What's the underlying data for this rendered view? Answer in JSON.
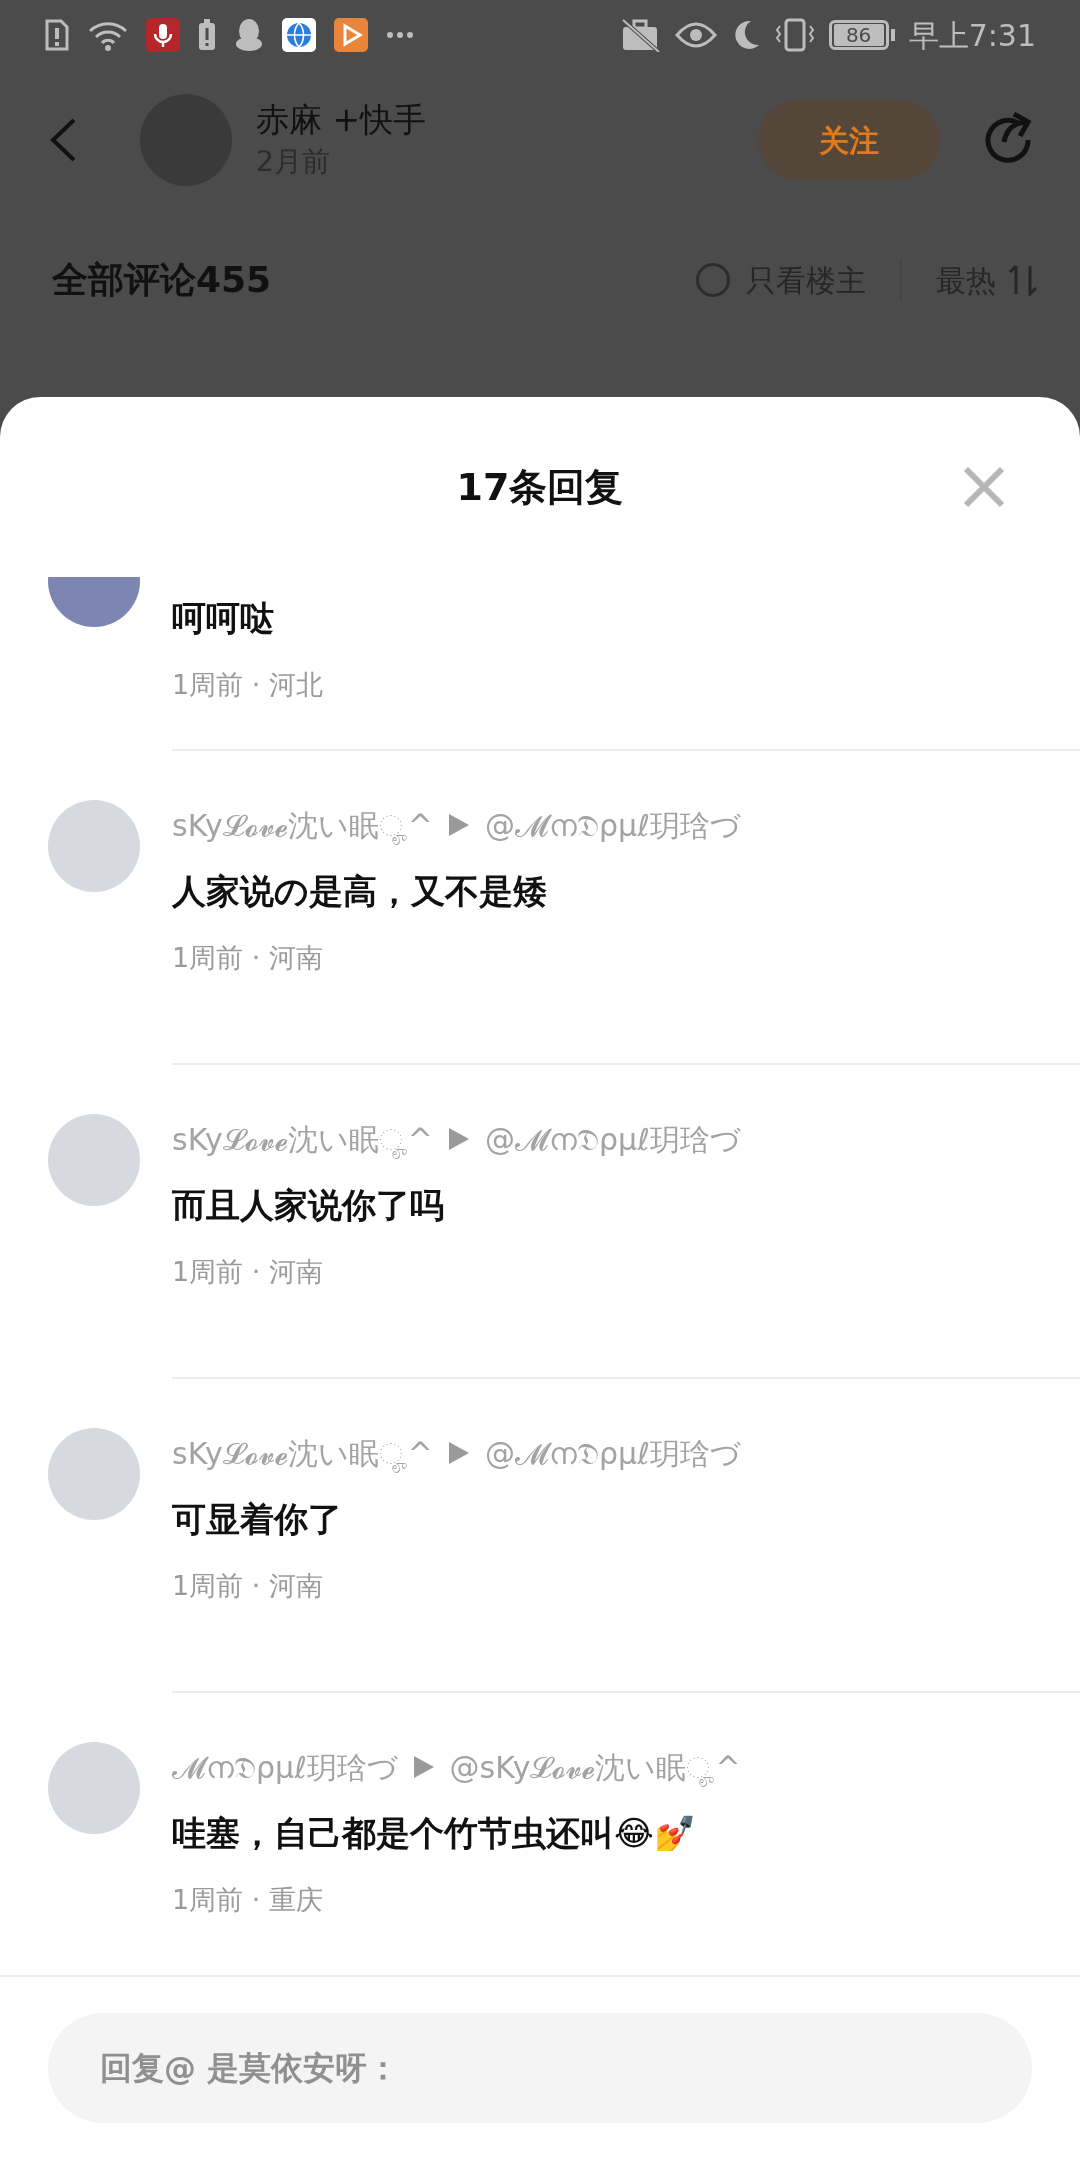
{
  "status_bar": {
    "battery": "86",
    "time": "早上7:31"
  },
  "post_header": {
    "author": "赤麻 +快手",
    "time": "2月前",
    "follow_button": "关注"
  },
  "comments_bar": {
    "title": "全部评论455",
    "owner_only": {
      "label": "只看楼主",
      "checked": false
    },
    "sort": "最热"
  },
  "reply_sheet": {
    "title": "17条回复",
    "replies": [
      {
        "kind": "partial",
        "text": "呵呵哒",
        "meta": "1周前 · 河北"
      },
      {
        "kind": "full",
        "author": "sKy𝓛𝓸𝓿𝓮沈い眠ೄ^",
        "reply_to": "@𝓜ന𝔇ρμℓ玥琀づ",
        "text": "人家说の是高，又不是矮",
        "meta": "1周前 · 河南"
      },
      {
        "kind": "full",
        "author": "sKy𝓛𝓸𝓿𝓮沈い眠ೄ^",
        "reply_to": "@𝓜ന𝔇ρμℓ玥琀づ",
        "text": "而且人家说你了吗",
        "meta": "1周前 · 河南"
      },
      {
        "kind": "full",
        "author": "sKy𝓛𝓸𝓿𝓮沈い眠ೄ^",
        "reply_to": "@𝓜ന𝔇ρμℓ玥琀づ",
        "text": "可显着你了",
        "meta": "1周前 · 河南"
      },
      {
        "kind": "full",
        "author": "𝓜ന𝔇ρμℓ玥琀づ",
        "reply_to": "@sKy𝓛𝓸𝓿𝓮沈い眠ೄ^",
        "text": "哇塞，自己都是个竹节虫还叫😂💅",
        "meta": "1周前 · 重庆"
      }
    ],
    "input": {
      "placeholder": "回复@ 是莫依安呀："
    }
  }
}
